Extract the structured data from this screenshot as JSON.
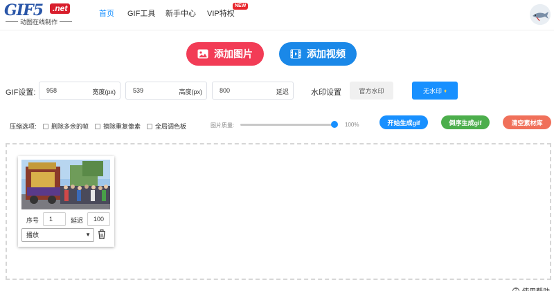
{
  "logo": {
    "main": "GIF5",
    "badge": ".net",
    "tagline": "动图在线制作"
  },
  "nav": {
    "items": [
      {
        "label": "首页",
        "active": true
      },
      {
        "label": "GIF工具",
        "active": false
      },
      {
        "label": "新手中心",
        "active": false
      },
      {
        "label": "VIP特权",
        "active": false
      }
    ],
    "new_badge": "NEW"
  },
  "actions": {
    "add_image": "添加图片",
    "add_video": "添加视频"
  },
  "gif_settings": {
    "label": "GIF设置:",
    "width": {
      "value": "958",
      "unit": "宽度(px)"
    },
    "height": {
      "value": "539",
      "unit": "高度(px)"
    },
    "delay": {
      "value": "800",
      "unit": "延迟"
    },
    "watermark_label": "水印设置",
    "watermark_official": "官方水印",
    "watermark_none": "无水印"
  },
  "compression": {
    "label": "压缩选项:",
    "opt_remove_frames": "删除多余的帧",
    "opt_remove_pixels": "擦除重复像素",
    "opt_global_palette": "全局调色板",
    "quality_label": "图片质量:",
    "quality_value": "100%",
    "quality_fraction": 1.0
  },
  "buttons": {
    "start": "开始生成gif",
    "reverse": "倒序生成gif",
    "clear": "清空素材库"
  },
  "frame": {
    "index_label": "序号",
    "index_value": "1",
    "delay_label": "延迟",
    "delay_value": "100",
    "mode_value": "播放"
  },
  "footer": {
    "help": "使用帮助"
  },
  "colors": {
    "primary": "#1890ff",
    "pink": "#f23c56",
    "green": "#4cae4c",
    "red": "#f0705a"
  }
}
